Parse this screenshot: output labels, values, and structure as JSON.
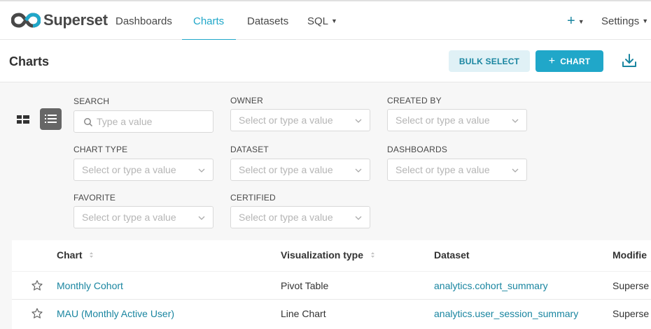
{
  "nav": {
    "logo_text": "Superset",
    "items": [
      {
        "label": "Dashboards"
      },
      {
        "label": "Charts"
      },
      {
        "label": "Datasets"
      },
      {
        "label": "SQL"
      }
    ],
    "plus_label": "+",
    "settings_label": "Settings",
    "active_color": "#20a7c9"
  },
  "header": {
    "title": "Charts",
    "bulk_select_label": "BULK SELECT",
    "add_chart_label": "CHART",
    "add_chart_plus": "+"
  },
  "filters": {
    "search": {
      "label": "SEARCH",
      "placeholder": "Type a value"
    },
    "owner": {
      "label": "OWNER",
      "placeholder": "Select or type a value"
    },
    "created_by": {
      "label": "CREATED BY",
      "placeholder": "Select or type a value"
    },
    "chart_type": {
      "label": "CHART TYPE",
      "placeholder": "Select or type a value"
    },
    "dataset": {
      "label": "DATASET",
      "placeholder": "Select or type a value"
    },
    "dashboards": {
      "label": "DASHBOARDS",
      "placeholder": "Select or type a value"
    },
    "favorite": {
      "label": "FAVORITE",
      "placeholder": "Select or type a value"
    },
    "certified": {
      "label": "CERTIFIED",
      "placeholder": "Select or type a value"
    }
  },
  "table": {
    "columns": {
      "chart": "Chart",
      "viz_type": "Visualization type",
      "dataset": "Dataset",
      "modified_by": "Modifie"
    },
    "rows": [
      {
        "chart": "Monthly Cohort",
        "viz_type": "Pivot Table",
        "dataset": "analytics.cohort_summary",
        "modified_by": "Superse"
      },
      {
        "chart": "MAU (Monthly Active User)",
        "viz_type": "Line Chart",
        "dataset": "analytics.user_session_summary",
        "modified_by": "Superse"
      }
    ]
  },
  "icons": {
    "logo": "superset-infinity-icon",
    "download": "download-icon",
    "card_view": "grid-icon",
    "list_view": "list-icon",
    "star": "star-outline-icon"
  }
}
